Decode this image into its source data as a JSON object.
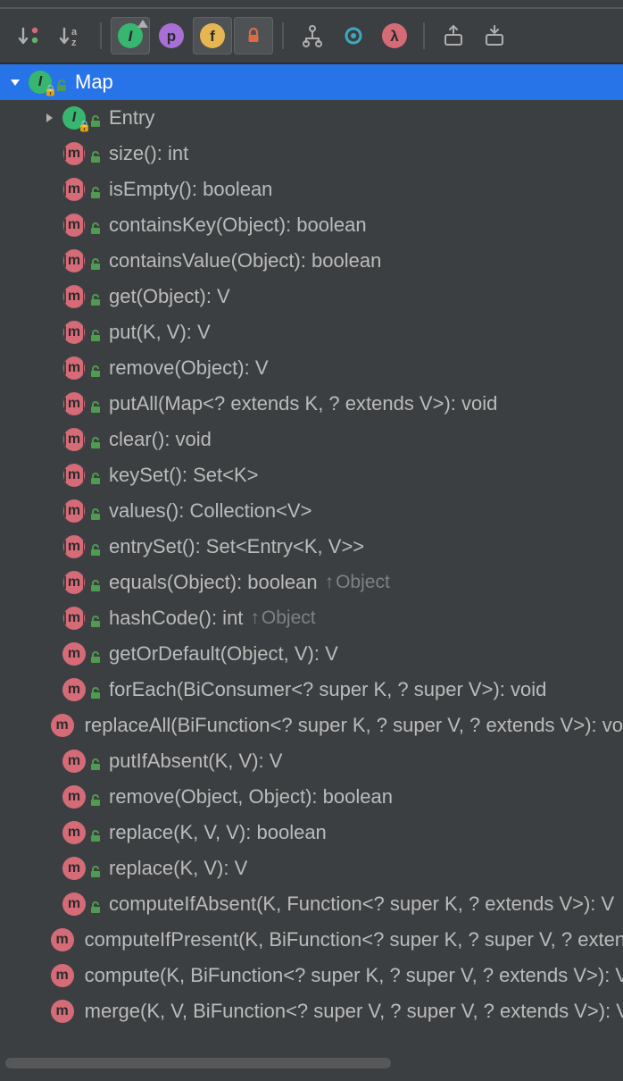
{
  "toolbar": {
    "sort_visibility_icon": "sort-visibility",
    "sort_alpha_icon": "sort-alpha",
    "btn_show_interfaces_glyph": "I",
    "btn_show_properties_glyph": "p",
    "btn_show_fields_glyph": "f",
    "btn_show_nonpublic_glyph": "🔒",
    "btn_show_inherited_icon": "inherited",
    "btn_show_anonymous_icon": "anonymous",
    "btn_show_lambdas_glyph": "λ",
    "btn_expand_all_icon": "expand-all",
    "btn_collapse_all_icon": "collapse-all"
  },
  "tree": {
    "root": {
      "label": "Map",
      "kind": "interface",
      "expanded": true,
      "selected": true
    },
    "members": [
      {
        "kind": "interface",
        "expandable": true,
        "label": "Entry"
      },
      {
        "kind": "abstract",
        "label": "size(): int"
      },
      {
        "kind": "abstract",
        "label": "isEmpty(): boolean"
      },
      {
        "kind": "abstract",
        "label": "containsKey(Object): boolean"
      },
      {
        "kind": "abstract",
        "label": "containsValue(Object): boolean"
      },
      {
        "kind": "abstract",
        "label": "get(Object): V"
      },
      {
        "kind": "abstract",
        "label": "put(K, V): V"
      },
      {
        "kind": "abstract",
        "label": "remove(Object): V"
      },
      {
        "kind": "abstract",
        "label": "putAll(Map<? extends K, ? extends V>): void"
      },
      {
        "kind": "abstract",
        "label": "clear(): void"
      },
      {
        "kind": "abstract",
        "label": "keySet(): Set<K>"
      },
      {
        "kind": "abstract",
        "label": "values(): Collection<V>"
      },
      {
        "kind": "abstract",
        "label": "entrySet(): Set<Entry<K, V>>"
      },
      {
        "kind": "abstract",
        "label": "equals(Object): boolean",
        "origin": "Object"
      },
      {
        "kind": "abstract",
        "label": "hashCode(): int",
        "origin": "Object"
      },
      {
        "kind": "default",
        "label": "getOrDefault(Object, V): V"
      },
      {
        "kind": "default",
        "label": "forEach(BiConsumer<? super K, ? super V>): void"
      },
      {
        "kind": "default",
        "label": "replaceAll(BiFunction<? super K, ? super V, ? extends V>): void"
      },
      {
        "kind": "default",
        "label": "putIfAbsent(K, V): V"
      },
      {
        "kind": "default",
        "label": "remove(Object, Object): boolean"
      },
      {
        "kind": "default",
        "label": "replace(K, V, V): boolean"
      },
      {
        "kind": "default",
        "label": "replace(K, V): V"
      },
      {
        "kind": "default",
        "label": "computeIfAbsent(K, Function<? super K, ? extends V>): V"
      },
      {
        "kind": "default",
        "label": "computeIfPresent(K, BiFunction<? super K, ? super V, ? extends V>): V"
      },
      {
        "kind": "default",
        "label": "compute(K, BiFunction<? super K, ? super V, ? extends V>): V"
      },
      {
        "kind": "default",
        "label": "merge(K, V, BiFunction<? super V, ? super V, ? extends V>): V"
      }
    ]
  }
}
